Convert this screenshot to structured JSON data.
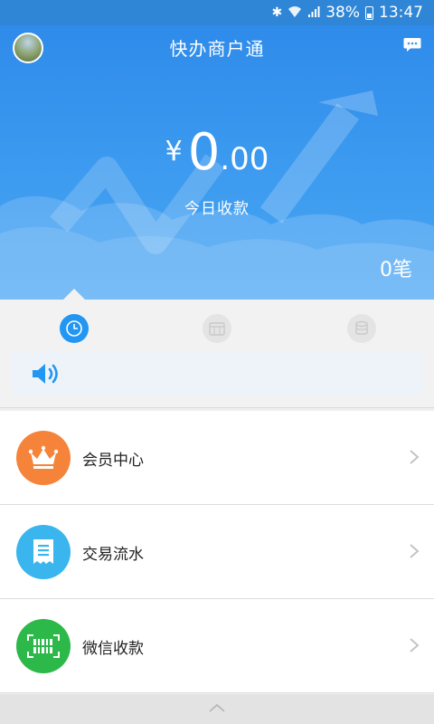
{
  "status_bar": {
    "battery": "38%",
    "time": "13:47"
  },
  "header": {
    "title": "快办商户通",
    "avatar_icon": "avatar-photo",
    "message_icon": "chat-bubble-icon"
  },
  "summary": {
    "currency": "¥",
    "amount_int": "0",
    "amount_dec": ".00",
    "label": "今日收款",
    "count": "0笔"
  },
  "tabs": [
    {
      "icon": "clock-icon",
      "active": true
    },
    {
      "icon": "calendar-icon",
      "active": false
    },
    {
      "icon": "coins-icon",
      "active": false
    }
  ],
  "notice": {
    "icon": "speaker-icon"
  },
  "menu": [
    {
      "label": "会员中心",
      "icon": "crown-icon",
      "color": "#f5843a"
    },
    {
      "label": "交易流水",
      "icon": "receipt-icon",
      "color": "#3ab5ee"
    },
    {
      "label": "微信收款",
      "icon": "barcode-icon",
      "color": "#2db84a"
    }
  ],
  "colors": {
    "primary": "#2f8bea",
    "tab_active": "#2196f3"
  }
}
